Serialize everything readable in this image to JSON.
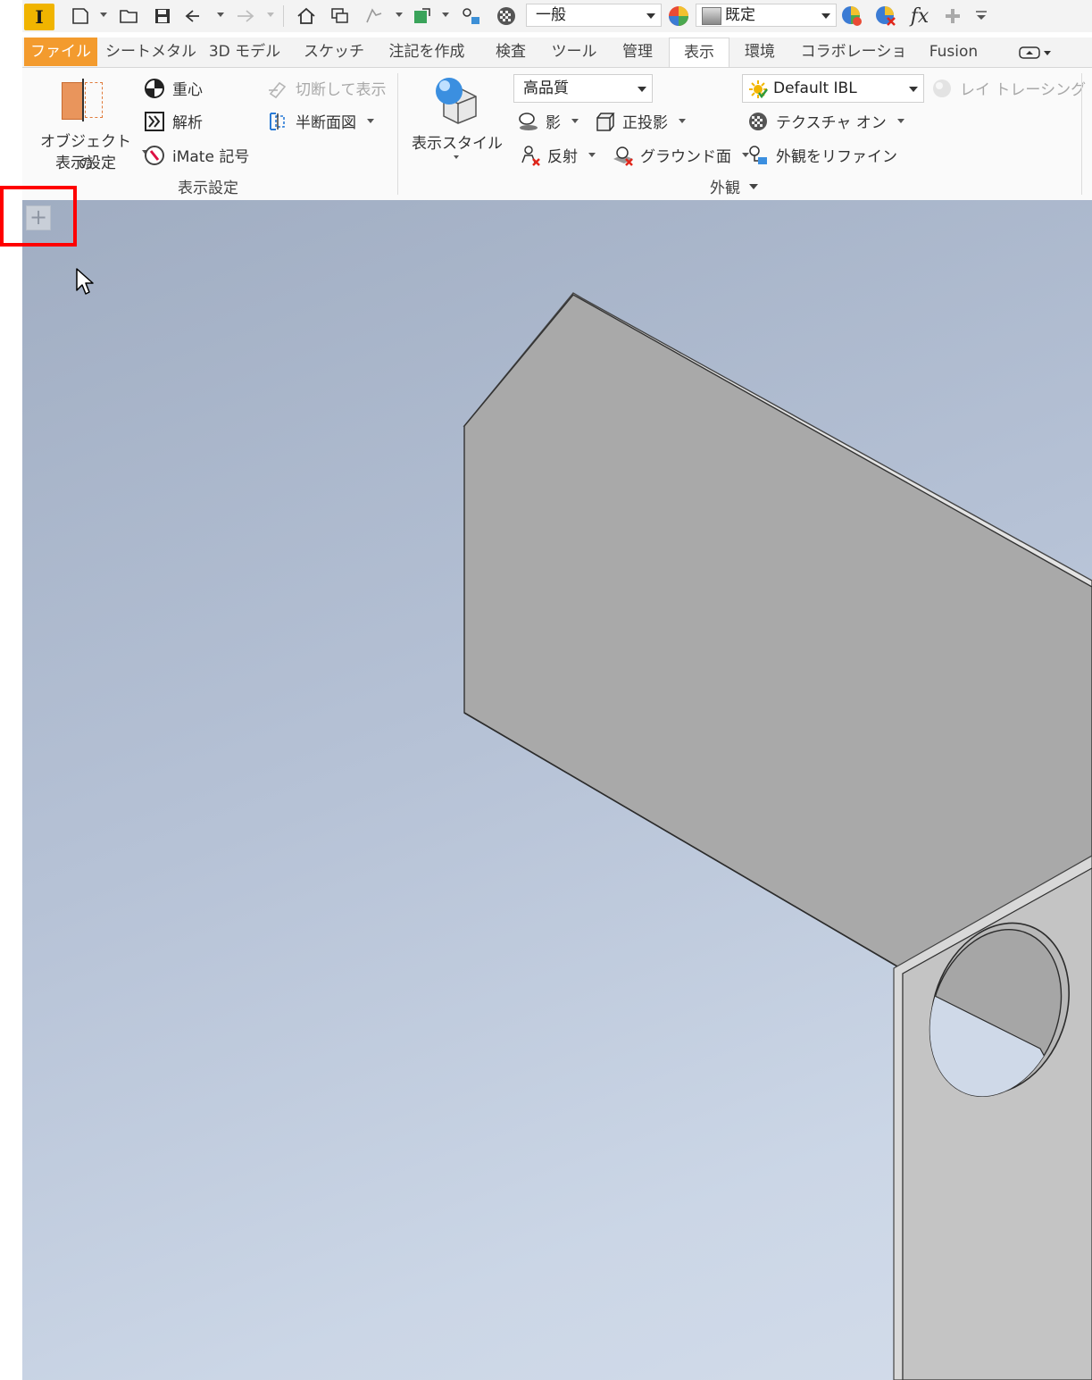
{
  "qat": {
    "app_icon_letter": "I",
    "style_combo": "一般",
    "appearance_combo": "既定",
    "fx_label": "fx"
  },
  "tabs": [
    {
      "label": "ファイル"
    },
    {
      "label": "シートメタル"
    },
    {
      "label": "3D モデル"
    },
    {
      "label": "スケッチ"
    },
    {
      "label": "注記を作成"
    },
    {
      "label": "検査"
    },
    {
      "label": "ツール"
    },
    {
      "label": "管理"
    },
    {
      "label": "表示"
    },
    {
      "label": "環境"
    },
    {
      "label": "コラボレーション"
    },
    {
      "label": "Fusion"
    }
  ],
  "ribbon": {
    "object_display_line1": "オブジェクトの",
    "object_display_line2": "表示設定",
    "center_of_gravity": "重心",
    "analysis": "解析",
    "imate_symbol": "iMate 記号",
    "slice_graphics": "切断して表示",
    "half_section": "半断面図",
    "group_display_settings": "表示設定",
    "visual_style": "表示スタイル",
    "quality_combo": "高品質",
    "shadows": "影",
    "orthographic": "正投影",
    "reflections": "反射",
    "ground_plane": "グラウンド面",
    "lighting_combo": "Default IBL",
    "ray_tracing": "レイ トレーシング",
    "texture_on": "テクスチャ オン",
    "refine_appearance": "外観をリファイン",
    "group_appearance": "外観"
  },
  "viewport": {
    "plus_label": "+"
  }
}
